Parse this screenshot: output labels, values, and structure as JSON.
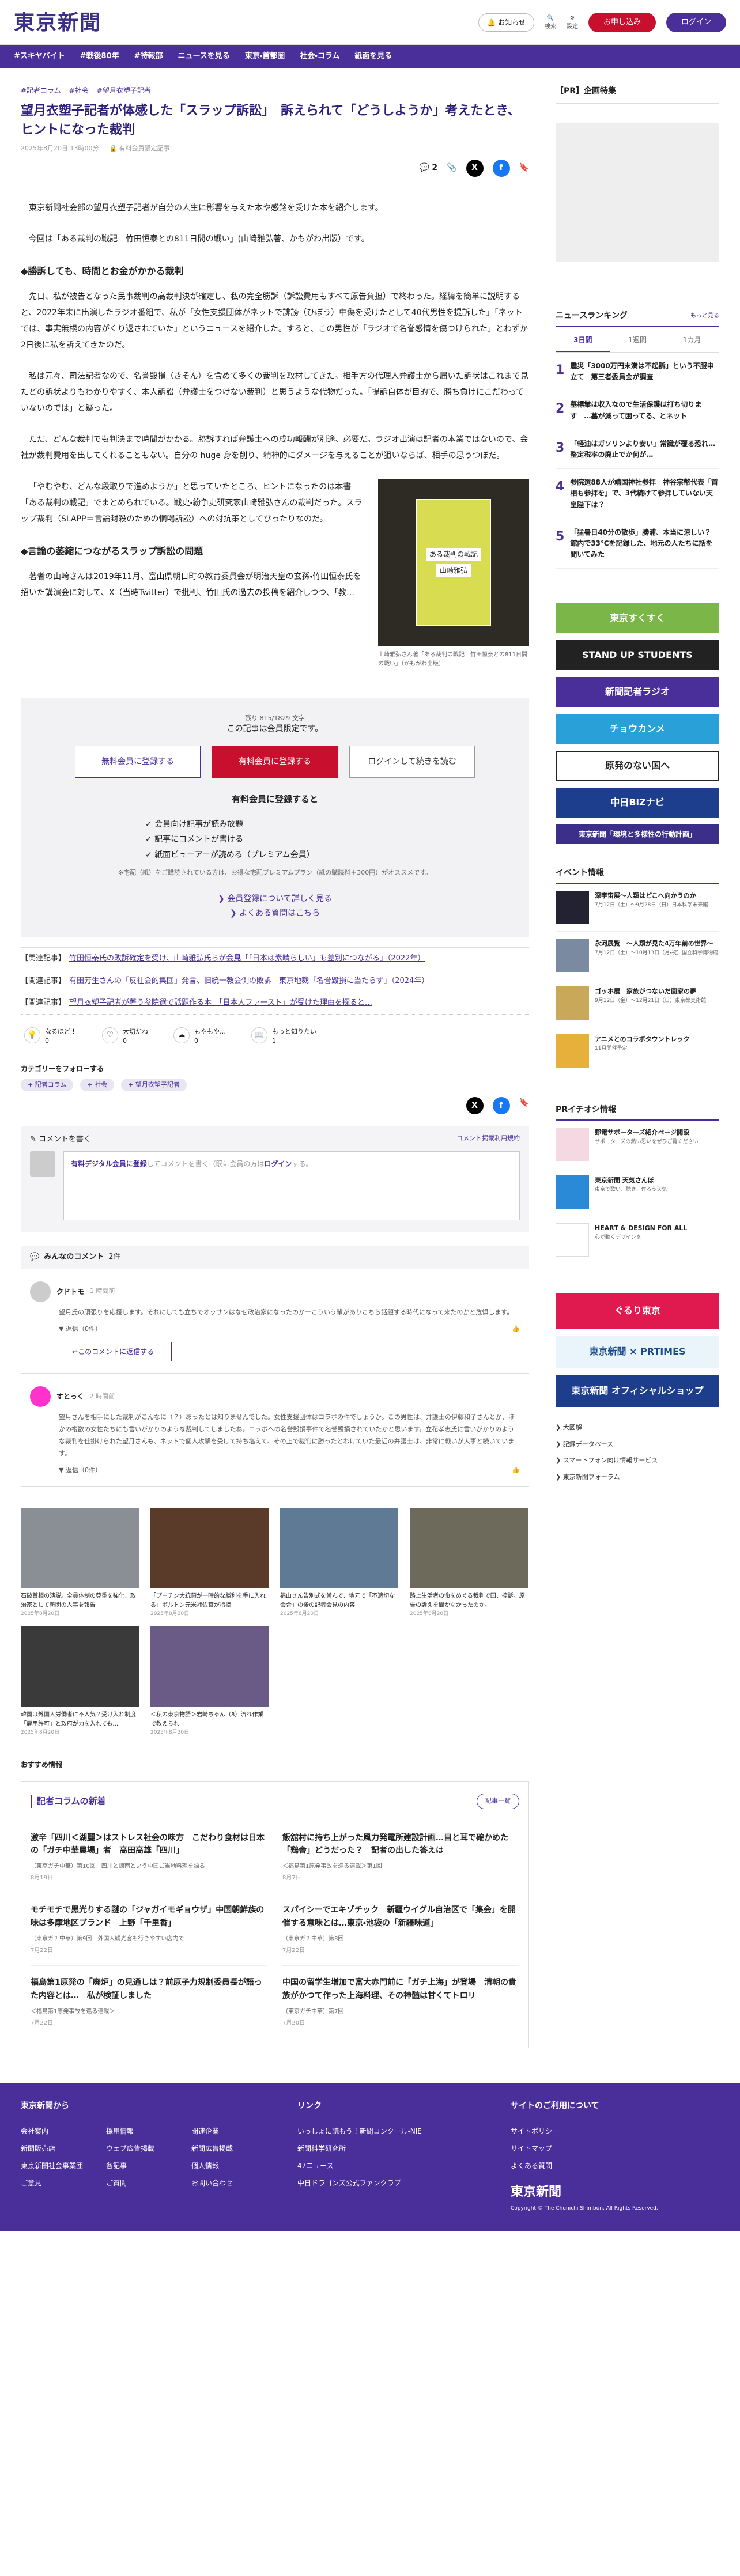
{
  "header": {
    "logo": "東京新聞",
    "notice": "お知らせ",
    "search": "検索",
    "settings": "設定",
    "register": "お申し込み",
    "login": "ログイン"
  },
  "nav": [
    "#スキヤバイト",
    "#戦後80年",
    "#特報部",
    "ニュースを見る",
    "東京・首都圏",
    "社会・コラム",
    "紙面を見る"
  ],
  "article": {
    "tags": [
      "#記者コラム",
      "#社会",
      "#望月衣塑子記者"
    ],
    "title": "望月衣塑子記者が体感した「スラップ訴訟」　訴えられて「どうしようか」考えたとき、ヒントになった裁判",
    "date": "2025年8月20日 13時00分",
    "badge": "有料会員限定記事",
    "comments": "2",
    "p1": "東京新聞社会部の望月衣塑子記者が自分の人生に影響を与えた本や感銘を受けた本を紹介します。",
    "p2": "今回は「ある裁判の戦記　竹田恒泰との811日間の戦い」(山崎雅弘著、かもがわ出版）です。",
    "h1": "◆勝訴しても、時間とお金がかかる裁判",
    "p3": "先日、私が被告となった民事裁判の高裁判決が確定し、私の完全勝訴（訴訟費用もすべて原告負担）で終わった。経緯を簡単に説明すると、2022年末に出演したラジオ番組で、私が「女性支援団体がネットで誹謗（ひぼう）中傷を受けたとして40代男性を提訴した」「ネットでは、事実無根の内容がくり返されていた」というニュースを紹介した。すると、この男性が「ラジオで名誉感情を傷つけられた」とわずか2日後に私を訴えてきたのだ。",
    "p4": "私は元々、司法記者なので、名誉毀損（きそん）を含めて多くの裁判を取材してきた。相手方の代理人弁護士から届いた訴状はこれまで見たどの訴状よりもわかりやすく、本人訴訟（弁護士をつけない裁判）と思うような代物だった。「提訴自体が目的で、勝ち負けにこだわっていないのでは」と疑った。",
    "p5": "ただ、どんな裁判でも判決まで時間がかかる。勝訴すれば弁護士への成功報酬が別途、必要だ。ラジオ出演は記者の本業ではないので、会社が裁判費用を出してくれることもない。自分の huge 身を削り、精神的にダメージを与えることが狙いならば、相手の思うつぼだ。",
    "p6": "「やむやむ、どんな段取りで進めようか」と思っていたところ、ヒントになったのは本書「ある裁判の戦記」でまとめられている。戦史・紛争史研究家山崎雅弘さんの裁判だった。スラップ裁判（SLAPP＝言論封殺のための恫喝訴訟）への対抗策としてぴったりなのだ。",
    "h2": "◆言論の萎縮につながるスラップ訴訟の問題",
    "p7": "著者の山崎さんは2019年11月、富山県朝日町の教育委員会が明治天皇の玄孫・竹田恒泰氏を招いた講演会に対して、X（当時Twitter）で批判、竹田氏の過去の投稿を紹介しつつ、「教…",
    "fig_caption": "山崎雅弘さん著「ある裁判の戦記　竹田恒泰との811日間の戦い」（かもがわ出版）",
    "book_title": "ある裁判の戦記",
    "book_author": "山崎雅弘"
  },
  "paywall": {
    "count": "残り 815/1829 文字",
    "limited": "この記事は会員限定です。",
    "free_btn": "無料会員に登録する",
    "paid_btn": "有料会員に登録する",
    "login_btn": "ログインして続きを読む",
    "paid_head": "有料会員に登録すると",
    "benefits": [
      "会員向け記事が読み放題",
      "記事にコメントが書ける",
      "紙面ビューアーが読める（プレミアム会員）"
    ],
    "note": "※宅配（紙）をご購読されている方は、お得な宅配プレミアムプラン（紙の購読料＋300円）がオススメです。",
    "link1": "会員登録について詳しく見る",
    "link2": "よくある質問はこちら"
  },
  "related": [
    {
      "tag": "【関連記事】",
      "text": "竹田恒泰氏の敗訴確定を受け、山崎雅弘氏らが会見「「日本は素晴らしい」も差別につながる」（2022年）"
    },
    {
      "tag": "【関連記事】",
      "text": "有田芳生さんの「反社会的集団」発言、旧統一教会側の敗訴　東京地裁「名誉毀損に当たらず」（2024年）"
    },
    {
      "tag": "【関連記事】",
      "text": "望月衣塑子記者が著う参院選で話題作る本　「日本人ファースト」が受けた理由を探ると…"
    }
  ],
  "reactions": [
    {
      "l": "なるほど！",
      "n": "0"
    },
    {
      "l": "大切だね",
      "n": "0"
    },
    {
      "l": "もやもや…",
      "n": "0"
    },
    {
      "l": "もっと知りたい",
      "n": "1"
    }
  ],
  "follow": {
    "title": "カテゴリーをフォローする",
    "tags": [
      "記者コラム",
      "社会",
      "望月衣塑子記者"
    ]
  },
  "comment_form": {
    "title": "コメントを書く",
    "policy": "コメント掲載利用規約",
    "placeholder_pre": "有料デジタル会員に登録",
    "placeholder_mid": "してコメントを書く（既に会員の方は",
    "placeholder_login": "ログイン",
    "placeholder_post": "する。"
  },
  "all_comments": {
    "title": "みんなのコメント",
    "count": "2件"
  },
  "comments": [
    {
      "user": "クドトモ",
      "date": "1 時間前",
      "text": "望月氏の頑張りを応援します。それにしても立ちでオッサンはなぜ政治家になったのかーこういう輩がありこちら話題する時代になって来たのかと危惧します。",
      "more": "返信（0件）",
      "reply": "このコメントに返信する"
    },
    {
      "user": "すとっく",
      "date": "2 時間前",
      "text": "望月さんを相手にした裁判がこんなに（？）あったとは知りませんでした。女性支援団体はコラボの件でしょうか。この男性は、弁護士の伊藤和子さんとか、ほかの複数の女性たちにも言いがかりのような裁判してしましたね。コラボへの名誉毀損事件で名誉毀損されていたかと思います。立花孝志氏に言いがかりのような裁判を仕掛けられた望月さんも、ネットで個人攻撃を受けて持ち堪えて、その上で裁判に勝ったとわけていた最近の弁護士は、非常に戦いが大事と続いています。",
      "more": "返信（0件）"
    }
  ],
  "grid": [
    {
      "c": "石破首相の演説。全員体制の尊重を強化、政治家として新閣の人事を報告",
      "d": "2025年8月20日"
    },
    {
      "c": "「プーチン大統領が一時的な勝利を手に入れる」ボルトン元米補佐官が指摘",
      "d": "2025年8月20日"
    },
    {
      "c": "福山さん告別式を営んで、地元で「不適切な会合」の後の記者会見の内容",
      "d": "2025年8月20日"
    },
    {
      "c": "路上生活者の命をめぐる裁判で国、控訴。原告の訴えを聞かなかったのか。",
      "d": "2025年8月20日"
    },
    {
      "c": "韓国は外国人労働者に不人気？受け入れ制度「雇用許可」と政府が力を入れても…",
      "d": "2025年8月20日"
    },
    {
      "c": "＜私の東京物語＞岩崎ちゃん（8）流れ作業で教えられ",
      "d": "2025年8月20日"
    }
  ],
  "recommend": "おすすめ情報",
  "column": {
    "title": "記者コラムの新着",
    "more": "記事一覧",
    "items": [
      {
        "t": "激辛「四川＜湖麗＞はストレス社会の味方　こだわり食材は日本の「ガチ中華農場」者　高田高雄「四川」",
        "s": "（東京ガチ中華）第10回　四川と湖南という中国ご当地料理を語る",
        "d": "8月19日"
      },
      {
        "t": "飯舘村に持ち上がった風力発電所建設計画…目と耳で確かめた「鶏舎」どうだった？　記者の出した答えは",
        "s": "＜福島第1原発事故を巡る連載＞第1回",
        "d": "8月7日"
      },
      {
        "t": "モチモチで黒光りする謎の「ジャガイモギョウザ」中国朝鮮族の味は多摩地区ブランド　上野「千里香」",
        "s": "（東京ガチ中華）第9回　外国人観光客も行きやすい店内で",
        "d": "7月22日"
      },
      {
        "t": "スパイシーでエキゾチック　新疆ウイグル自治区で「集会」を開催する意味とは…東京・池袋の「新疆味道」",
        "s": "（東京ガチ中華）第8回",
        "d": "7月22日"
      },
      {
        "t": "福島第1原発の「廃炉」の見通しは？前原子力規制委員長が語った内容とは…　私が検証しました",
        "s": "＜福島第1原発事故を巡る連載＞",
        "d": "7月22日"
      },
      {
        "t": "中国の留学生増加で富大赤門前に「ガチ上海」が登場　清朝の貴族がかつて作った上海料理、その神髄は甘くてトロリ",
        "s": "（東京ガチ中華）第7回",
        "d": "7月20日"
      }
    ]
  },
  "side": {
    "pr": "【PR】企画特集",
    "ranking_title": "ニュースランキング",
    "ranking_more": "もっと見る",
    "tabs": [
      "3日間",
      "1週間",
      "1カ月"
    ],
    "ranks": [
      {
        "n": "1",
        "t": "震災「3000万円末満は不起訴」という不服申立て　第三者委員会が調査"
      },
      {
        "n": "2",
        "t": "墓標業は収入なので生活保護は打ち切ります　…墓が減って困ってる、とネット"
      },
      {
        "n": "3",
        "t": "「軽油はガソリンより安い」常識が覆る恐れ…整定税率の廃止でか何が…"
      },
      {
        "n": "4",
        "t": "参院選88人が靖国神社参拝　神谷宗幣代表「首相も参拝を」で、3代続けて参拝していない天皇陛下は？"
      },
      {
        "n": "5",
        "t": "「猛暑日40分の散歩」勝浦、本当に涼しい？　館内で33℃を記録した、地元の人たちに話を聞いてみた"
      }
    ],
    "banners": [
      {
        "t": "東京すくすく",
        "bg": "#7ab648",
        "fg": "#fff"
      },
      {
        "t": "STAND UP STUDENTS",
        "bg": "#222",
        "fg": "#fff"
      },
      {
        "t": "新聞記者ラジオ",
        "bg": "#4a2f9a",
        "fg": "#fff"
      },
      {
        "t": "チョウカンメ",
        "bg": "#2aa0d8",
        "fg": "#fff"
      },
      {
        "t": "原発のない国へ",
        "bg": "#fff",
        "fg": "#222"
      },
      {
        "t": "中日BiZナビ",
        "bg": "#1d3e8c",
        "fg": "#fff"
      },
      {
        "t": "東京新聞「環境と多様性の行動計画」",
        "bg": "#3b2f8a",
        "fg": "#fff"
      }
    ],
    "events_title": "イベント情報",
    "events": [
      {
        "t": "深宇宙展～人類はどこへ向かうのか",
        "s": "7月12日（土）～9月28日（日）日本科学未来館"
      },
      {
        "t": "永河展覧　〜人類が見た4万年前の世界〜",
        "s": "7月12日（土）～10月13日（月・祝）国立科学博物館"
      },
      {
        "t": "ゴッホ展　家族がつないだ画家の夢",
        "s": "9月12日（金）～12月21日（日）東京都美術館"
      },
      {
        "t": "アニメとのコラボタウントレック",
        "s": "11月開催予定"
      }
    ],
    "pr_title": "PRイチオシ情報",
    "prs": [
      {
        "t": "郵電サポーターズ紹介ページ開設",
        "s": "サポーターズの熱い思いをぜひご覧ください"
      },
      {
        "t": "東京新聞 天気さんぽ",
        "s": "東京で歌い、聴き、作ろう天気"
      },
      {
        "t": "HEART & DESIGN FOR ALL",
        "s": "心が動くデザインを"
      }
    ],
    "shop": "東京新聞 オフィシャルショップ",
    "prtimes": "東京新聞 × PRTIMES",
    "gururi": "ぐるり東京",
    "links": [
      "大図解",
      "記録データベース",
      "スマートフォン向け情報サービス",
      "東京新聞フォーラム"
    ]
  },
  "footer": {
    "c1": "東京新聞から",
    "l1": [
      "会社案内",
      "採用情報",
      "問連企業",
      "新聞販売店",
      "ウェブ広告掲載",
      "新聞広告掲載",
      "東京新聞社会事業団",
      "各記事",
      "個人情報",
      "ご意見",
      "ご質問",
      "お問い合わせ"
    ],
    "c2": "リンク",
    "l2": [
      "いっしょに読もう！新聞コンクール・NIE",
      "新聞科学研究所",
      "47ニュース",
      "中日ドラゴンズ公式ファンクラブ"
    ],
    "c3": "サイトのご利用について",
    "l3": [
      "サイトポリシー",
      "サイトマップ",
      "よくある質問"
    ],
    "copy": "Copyright © The Chunichi Shimbun, All Rights Reserved."
  }
}
